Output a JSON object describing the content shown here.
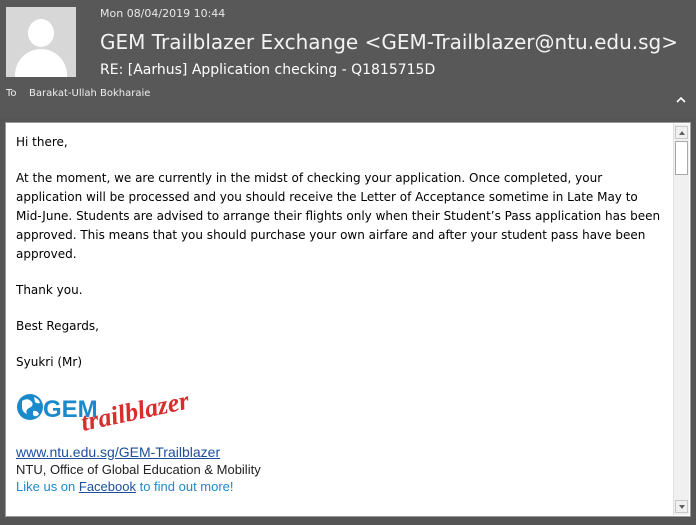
{
  "header": {
    "date": "Mon 08/04/2019 10:44",
    "from": "GEM Trailblazer Exchange <GEM-Trailblazer@ntu.edu.sg>",
    "subject": "RE: [Aarhus] Application checking - Q1815715D",
    "to_label": "To",
    "to_value": "Barakat-Ullah Bokharaie"
  },
  "body": {
    "greeting": "Hi there,",
    "paragraph": "At the moment, we are currently in the midst of checking your application. Once completed, your application will be processed and you should receive the Letter of Acceptance sometime in Late May to Mid-June. Students are advised to arrange their flights only when their Student’s Pass application has been approved. This means that you should purchase your own airfare and after your student pass have been approved.",
    "thanks": "Thank you.",
    "regards": "Best Regards,",
    "name": "Syukri (Mr)"
  },
  "signature": {
    "logo_text_1": "GEM",
    "logo_text_2": "trailblazer",
    "link": "www.ntu.edu.sg/GEM-Trailblazer",
    "office": "NTU, Office of Global Education & Mobility",
    "like_prefix": "Like us on ",
    "like_link": "Facebook",
    "like_suffix": " to find out more!"
  },
  "colors": {
    "header_bg": "#585858",
    "link": "#1b4f9c",
    "brand_red": "#d62d2d",
    "brand_blue": "#1b8acb"
  }
}
